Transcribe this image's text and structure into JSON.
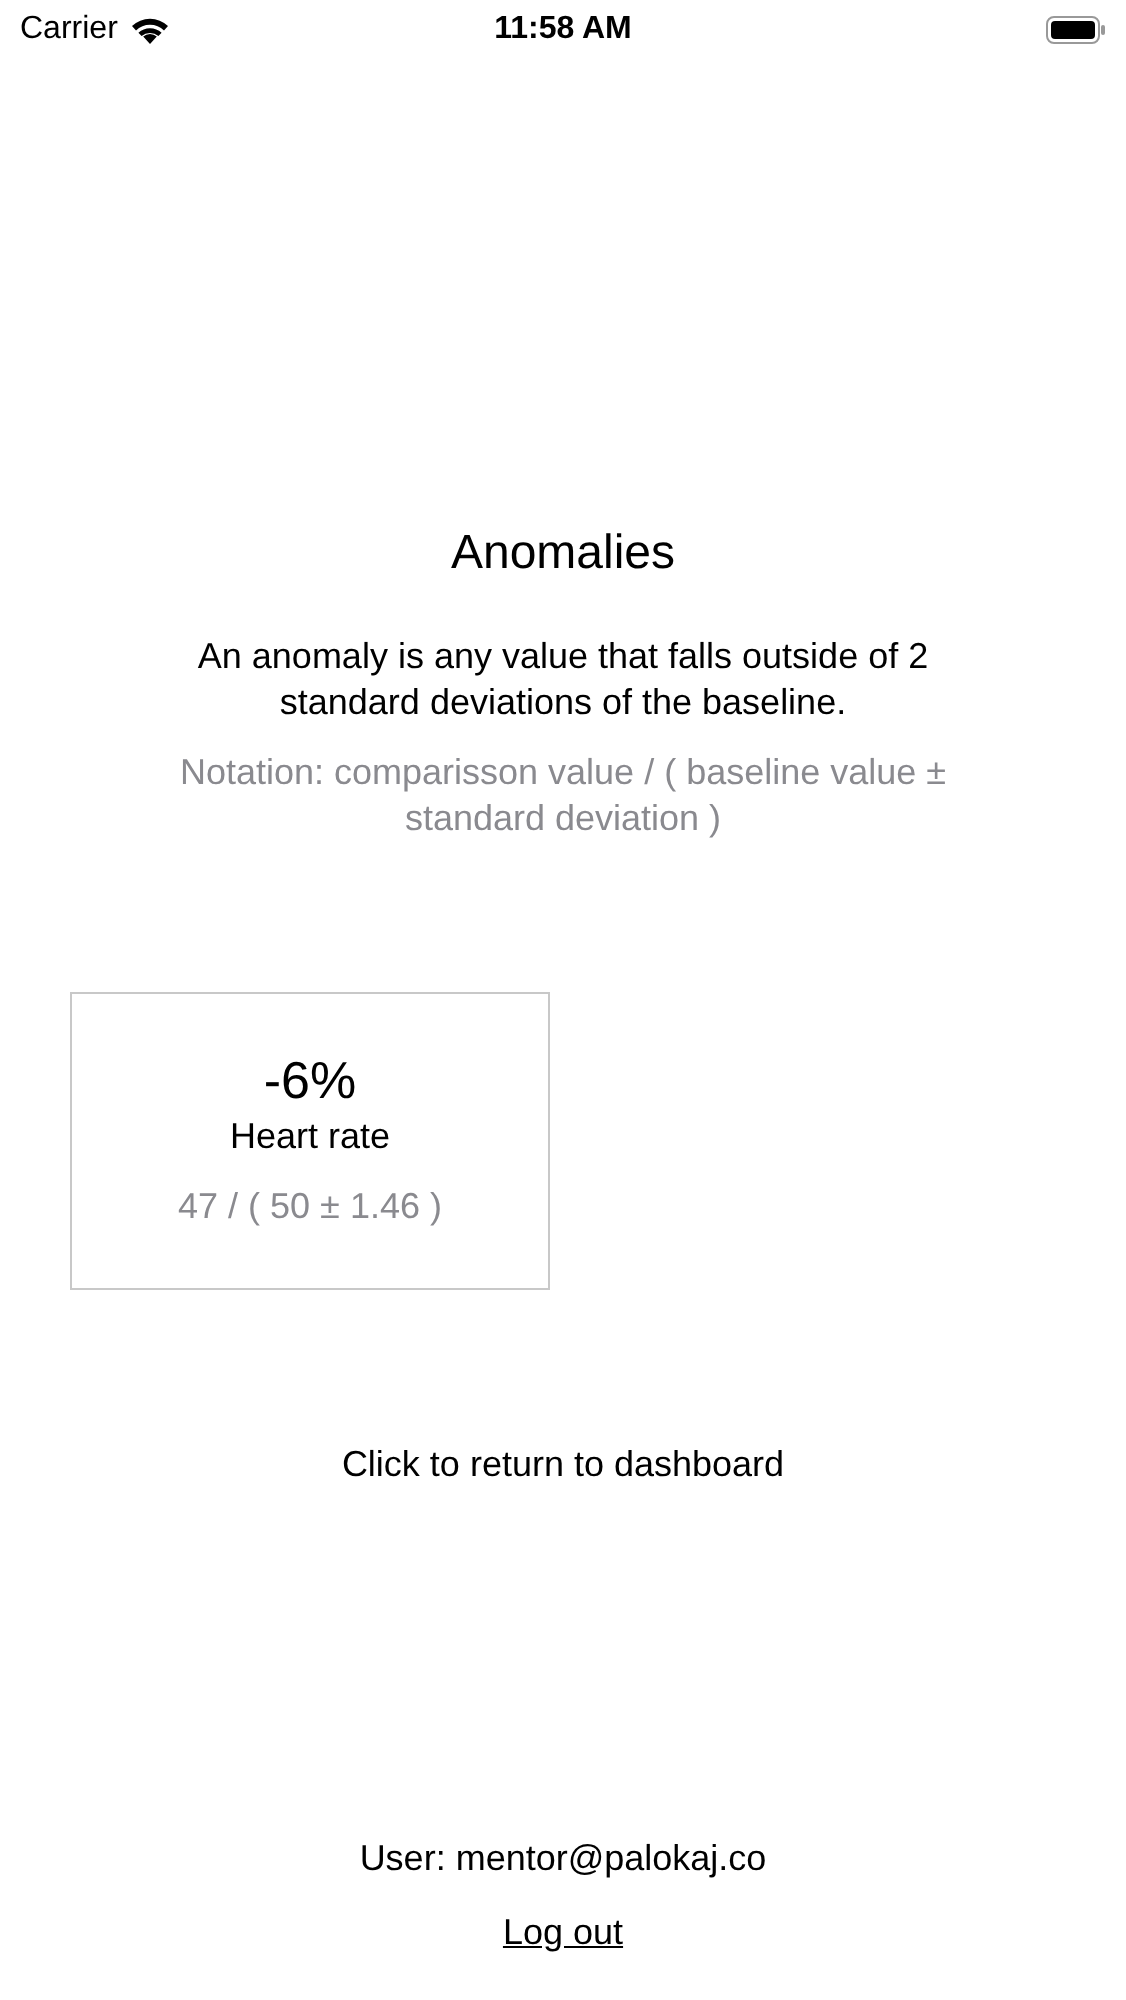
{
  "status_bar": {
    "carrier": "Carrier",
    "time": "11:58 AM"
  },
  "title": "Anomalies",
  "description": "An anomaly is any value that falls outside of 2 standard deviations of the baseline.",
  "notation": "Notation: comparisson value / ( baseline value ± standard deviation )",
  "anomalies": [
    {
      "change": "-6%",
      "metric": "Heart rate",
      "values": "47 / ( 50 ± 1.46 )"
    }
  ],
  "return_link": "Click to return to dashboard",
  "user": "User: mentor@palokaj.co",
  "logout": "Log out"
}
